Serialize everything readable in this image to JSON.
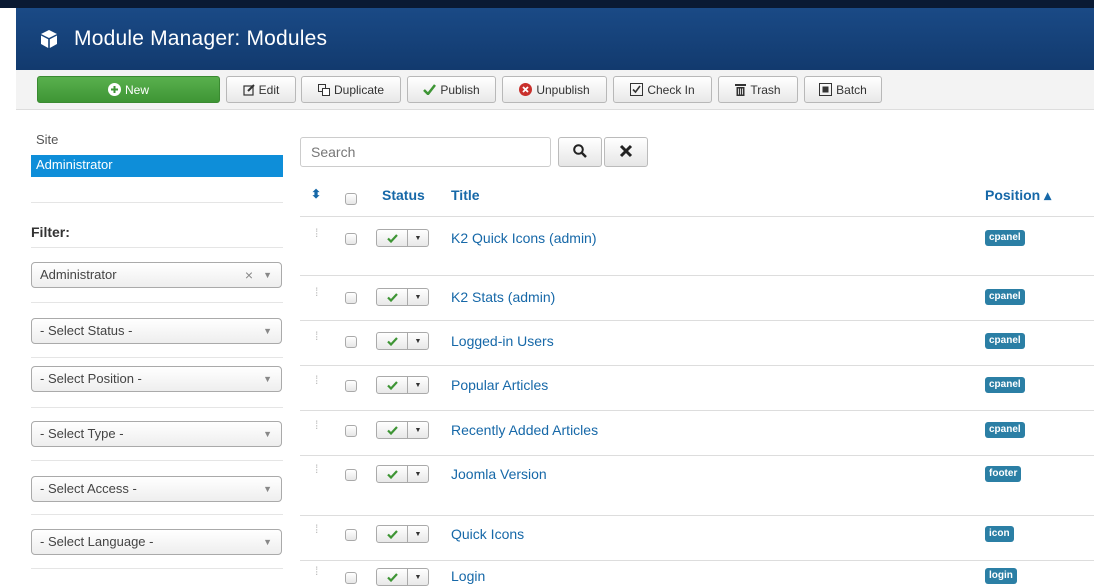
{
  "header": {
    "title": "Module Manager: Modules",
    "icon": "cube-icon"
  },
  "toolbar": {
    "new": "New",
    "edit": "Edit",
    "duplicate": "Duplicate",
    "publish": "Publish",
    "unpublish": "Unpublish",
    "checkin": "Check In",
    "trash": "Trash",
    "batch": "Batch"
  },
  "sidebar": {
    "links": [
      "Site",
      "Administrator"
    ],
    "active": "Administrator",
    "filter_label": "Filter:",
    "filters": [
      "Administrator",
      "- Select Status -",
      "- Select Position -",
      "- Select Type -",
      "- Select Access -",
      "- Select Language -"
    ]
  },
  "search": {
    "placeholder": "Search"
  },
  "table": {
    "headers": {
      "status": "Status",
      "title": "Title",
      "position": "Position ▴"
    },
    "rows": [
      {
        "title": "K2 Quick Icons (admin)",
        "position": "cpanel"
      },
      {
        "title": "K2 Stats (admin)",
        "position": "cpanel"
      },
      {
        "title": "Logged-in Users",
        "position": "cpanel"
      },
      {
        "title": "Popular Articles",
        "position": "cpanel"
      },
      {
        "title": "Recently Added Articles",
        "position": "cpanel"
      },
      {
        "title": "Joomla Version",
        "position": "footer"
      },
      {
        "title": "Quick Icons",
        "position": "icon"
      },
      {
        "title": "Login",
        "position": "login"
      }
    ]
  },
  "colors": {
    "accent": "#0e8ed9",
    "header": "#123a6e",
    "badge": "#2b7fa5",
    "new_button": "#4aa33f",
    "link": "#1668a8"
  }
}
